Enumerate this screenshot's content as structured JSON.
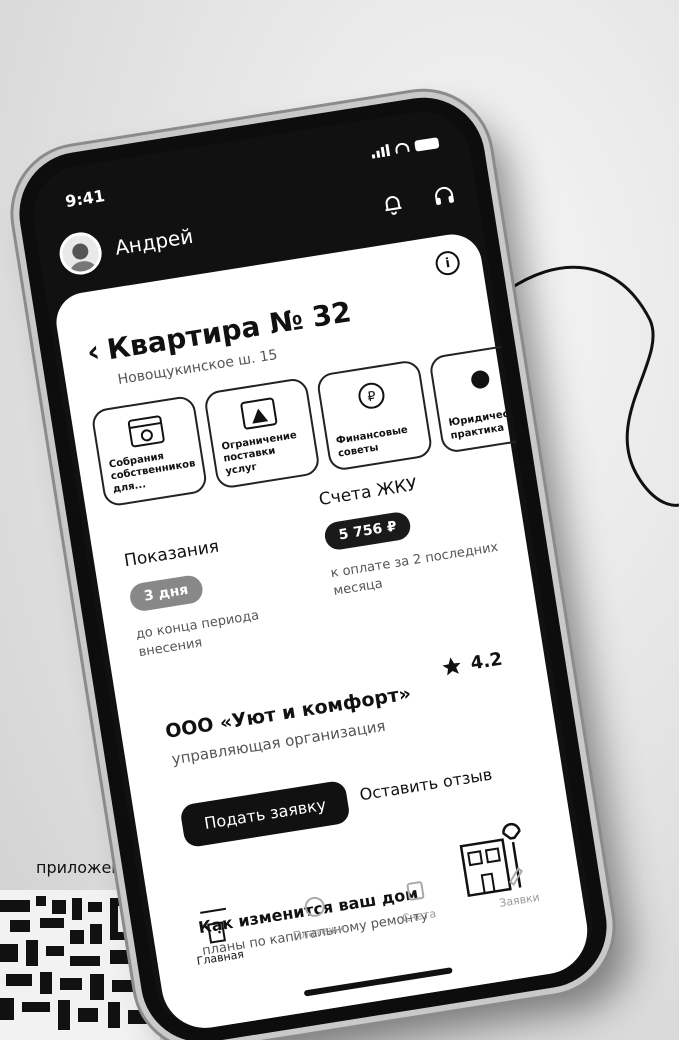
{
  "status_bar": {
    "time": "9:41"
  },
  "header": {
    "user_name": "Андрей"
  },
  "apartment": {
    "title": "Квартира № 32",
    "address": "Новощукинское ш. 15"
  },
  "services": [
    {
      "label": "Собрания собственников для...",
      "icon": "calendar-settings-icon"
    },
    {
      "label": "Ограничение поставки услуг",
      "icon": "warning-calendar-icon"
    },
    {
      "label": "Финансовые советы",
      "icon": "ruble-coin-icon"
    },
    {
      "label": "Юридическая практика",
      "icon": "legal-icon"
    }
  ],
  "meters": {
    "heading": "Показания",
    "badge": "3 дня",
    "note": "до конца периода внесения"
  },
  "bills": {
    "heading": "Счета ЖКУ",
    "amount": "5 756 ₽",
    "note": "к оплате за 2 последних месяца"
  },
  "company": {
    "name": "ООО «Уют и комфорт»",
    "role": "управляющая организация",
    "rating": "4.2",
    "submit_button": "Подать заявку",
    "review_link": "Оставить отзыв"
  },
  "house": {
    "title": "Как изменится ваш дом",
    "subtitle": "планы по капитальному ремонту"
  },
  "tabbar": [
    {
      "label": "Главная",
      "icon": "door-icon",
      "active": true
    },
    {
      "label": "Платежи",
      "icon": "payments-icon",
      "active": false
    },
    {
      "label": "Счета",
      "icon": "bills-icon",
      "active": false
    },
    {
      "label": "Заявки",
      "icon": "requests-icon",
      "active": false
    }
  ],
  "promo": {
    "caption": "приложение"
  }
}
